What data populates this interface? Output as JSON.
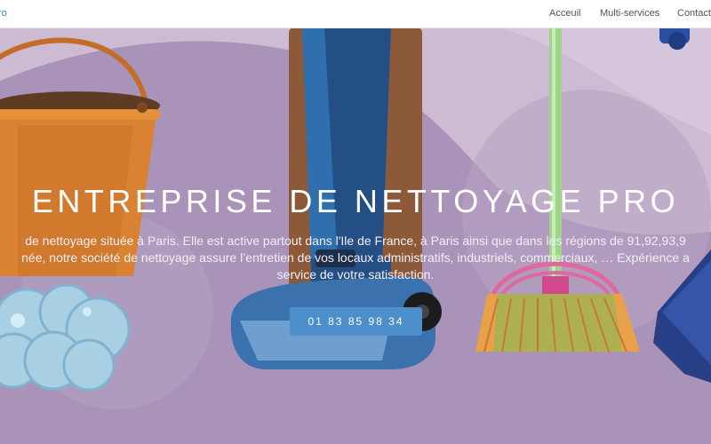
{
  "brand": {
    "text": "ro"
  },
  "nav": {
    "items": [
      "Acceuil",
      "Multi-services",
      "Contact"
    ]
  },
  "hero": {
    "title": "ENTREPRISE DE NETTOYAGE PRO",
    "description_lines": [
      " de nettoyage située à Paris. Elle est active partout dans l'Ile de France, à Paris ainsi que dans les régions de 91,92,93,9",
      "née, notre société de nettoyage assure l’entretien de vos locaux administratifs, industriels, commerciaux, … Expérience a",
      "service de votre satisfaction."
    ],
    "phone": "01 83 85 98 34"
  },
  "colors": {
    "accent": "#4d8fcb",
    "brand": "#2d8fd0",
    "hero_bg": "#cbb8d1"
  }
}
